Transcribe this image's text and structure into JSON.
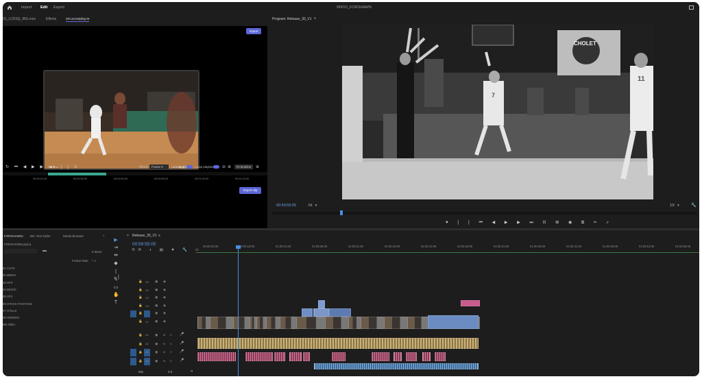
{
  "topbar": {
    "home_icon": "home-icon",
    "tabs": [
      "Import",
      "Edit",
      "Export"
    ],
    "active_tab": "Edit",
    "project_title": "WIFIO_FORSHAWN"
  },
  "source": {
    "tabs": [
      "01_LCDSQ_IRG.mov",
      "Effects",
      "sm.scoreplay.io"
    ],
    "import_label": "Import",
    "import_clip_label": "Import clip",
    "move_label": "Move",
    "frame_select": "Frame",
    "live_timeline_label": "Live timeline",
    "loop_playback_label": "Loop playback",
    "fit_timeline_label": "Fit timeline",
    "ruler": [
      "00:00:20:00",
      "00:00:30:00",
      "00:00:40:00",
      "00:00:50:00",
      "00:01:00:00",
      "00:01:10:00"
    ]
  },
  "program": {
    "title": "Program: Release_30_V1",
    "timecode": "00:59:55:05",
    "fit": "Fit",
    "scale": "1/2",
    "banner": "CHOLET",
    "jersey": "7",
    "jersey_right": "11"
  },
  "project": {
    "tabs": [
      "FORSHAWN",
      "Bin: Text folder",
      "Media Browser"
    ],
    "file": "FORSHAWN.prproj",
    "items_count": "9 items",
    "column": "Frame Rate",
    "folders": [
      "01 CUTS",
      "02 MEDIA",
      "03 SFX",
      "04 MUSIC",
      "05 SFX",
      "06 STOCK FOOTAGE",
      "07 STILLS",
      "08 HEROES",
      "Bin folder"
    ]
  },
  "timeline": {
    "tab": "Release_30_V1",
    "timecode": "00:59:55:05",
    "ruler": [
      "00:00:01:09",
      "00:00:16:09",
      "01:00:01:09",
      "01:00:06:09",
      "01:00:11:09",
      "01:00:16:09",
      "01:00:21:09",
      "01:00:26:09",
      "01:00:31:09",
      "01:00:36:09",
      "01:00:41:09",
      "01:00:46:09",
      "01:00:51:09",
      "01:00:56:09"
    ],
    "video_tracks": [
      "V6",
      "V5",
      "V4",
      "V3",
      "V2",
      "V1"
    ],
    "audio_tracks": [
      "A1",
      "A2",
      "A3",
      "A4"
    ],
    "mix_label": "Mix",
    "mix_value": "0.0"
  },
  "colors": {
    "accent": "#5d67d8",
    "playhead": "#4a8fdc",
    "video_clip": "#5a7fb8",
    "audio_clip": "#8c6a3a",
    "pink_clip": "#c85a8c"
  }
}
